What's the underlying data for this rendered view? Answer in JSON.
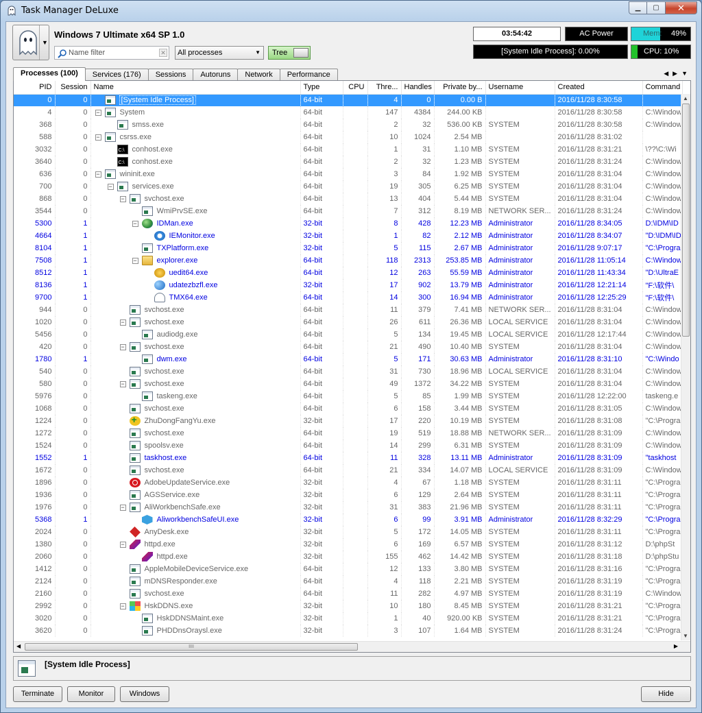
{
  "window": {
    "title": "Task Manager DeLuxe"
  },
  "header": {
    "os_name": "Windows 7 Ultimate x64 SP 1.0",
    "filter_placeholder": "Name filter",
    "process_scope": "All processes",
    "tree_label": "Tree"
  },
  "status": {
    "uptime": "03:54:42",
    "power": "AC Power",
    "mem_label": "Mem:",
    "mem_value": "49%",
    "mem_fraction": 0.49,
    "idle_text": "[System Idle Process]: 0.00%",
    "cpu_label": "CPU:",
    "cpu_value": "10%",
    "cpu_fraction": 0.1
  },
  "tabs": [
    {
      "label": "Processes (100)",
      "active": true
    },
    {
      "label": "Services (176)"
    },
    {
      "label": "Sessions"
    },
    {
      "label": "Autoruns"
    },
    {
      "label": "Network"
    },
    {
      "label": "Performance"
    }
  ],
  "columns": [
    "PID",
    "Session",
    "Name",
    "Type",
    "CPU",
    "Thre...",
    "Handles",
    "Private by...",
    "Username",
    "Created",
    "Command Line"
  ],
  "processes": [
    {
      "pid": "0",
      "session": "0",
      "depth": 0,
      "toggle": "",
      "icon": "win",
      "name": "[System Idle Process]",
      "type": "64-bit",
      "cpu": "",
      "threads": "4",
      "handles": "0",
      "private": "0.00 B",
      "user": "",
      "created": "2016/11/28 8:30:58",
      "cmd": "",
      "selected": true
    },
    {
      "pid": "4",
      "session": "0",
      "depth": 0,
      "toggle": "−",
      "icon": "win",
      "name": "System",
      "type": "64-bit",
      "cpu": "",
      "threads": "147",
      "handles": "4384",
      "private": "244.00 KB",
      "user": "",
      "created": "2016/11/28 8:30:58",
      "cmd": "C:\\Window"
    },
    {
      "pid": "368",
      "session": "0",
      "depth": 1,
      "toggle": "",
      "icon": "win",
      "name": "smss.exe",
      "type": "64-bit",
      "cpu": "",
      "threads": "2",
      "handles": "32",
      "private": "536.00 KB",
      "user": "SYSTEM",
      "created": "2016/11/28 8:30:58",
      "cmd": "C:\\Window"
    },
    {
      "pid": "588",
      "session": "0",
      "depth": 0,
      "toggle": "−",
      "icon": "win",
      "name": "csrss.exe",
      "type": "64-bit",
      "cpu": "",
      "threads": "10",
      "handles": "1024",
      "private": "2.54 MB",
      "user": "",
      "created": "2016/11/28 8:31:02",
      "cmd": ""
    },
    {
      "pid": "3032",
      "session": "0",
      "depth": 1,
      "toggle": "",
      "icon": "cmd",
      "name": "conhost.exe",
      "type": "64-bit",
      "cpu": "",
      "threads": "1",
      "handles": "31",
      "private": "1.10 MB",
      "user": "SYSTEM",
      "created": "2016/11/28 8:31:21",
      "cmd": "\\??\\C:\\Wi"
    },
    {
      "pid": "3640",
      "session": "0",
      "depth": 1,
      "toggle": "",
      "icon": "cmd",
      "name": "conhost.exe",
      "type": "64-bit",
      "cpu": "",
      "threads": "2",
      "handles": "32",
      "private": "1.23 MB",
      "user": "SYSTEM",
      "created": "2016/11/28 8:31:24",
      "cmd": "C:\\Window"
    },
    {
      "pid": "636",
      "session": "0",
      "depth": 0,
      "toggle": "−",
      "icon": "win",
      "name": "wininit.exe",
      "type": "64-bit",
      "cpu": "",
      "threads": "3",
      "handles": "84",
      "private": "1.92 MB",
      "user": "SYSTEM",
      "created": "2016/11/28 8:31:04",
      "cmd": "C:\\Window"
    },
    {
      "pid": "700",
      "session": "0",
      "depth": 1,
      "toggle": "−",
      "icon": "win",
      "name": "services.exe",
      "type": "64-bit",
      "cpu": "",
      "threads": "19",
      "handles": "305",
      "private": "6.25 MB",
      "user": "SYSTEM",
      "created": "2016/11/28 8:31:04",
      "cmd": "C:\\Window"
    },
    {
      "pid": "868",
      "session": "0",
      "depth": 2,
      "toggle": "−",
      "icon": "win",
      "name": "svchost.exe",
      "type": "64-bit",
      "cpu": "",
      "threads": "13",
      "handles": "404",
      "private": "5.44 MB",
      "user": "SYSTEM",
      "created": "2016/11/28 8:31:04",
      "cmd": "C:\\Window"
    },
    {
      "pid": "3544",
      "session": "0",
      "depth": 3,
      "toggle": "",
      "icon": "win",
      "name": "WmiPrvSE.exe",
      "type": "64-bit",
      "cpu": "",
      "threads": "7",
      "handles": "312",
      "private": "8.19 MB",
      "user": "NETWORK SER...",
      "created": "2016/11/28 8:31:24",
      "cmd": "C:\\Window"
    },
    {
      "pid": "5300",
      "session": "1",
      "depth": 3,
      "toggle": "−",
      "icon": "globe",
      "name": "IDMan.exe",
      "type": "32-bit",
      "cpu": "",
      "threads": "8",
      "handles": "428",
      "private": "12.23 MB",
      "user": "Administrator",
      "created": "2016/11/28 8:34:05",
      "cmd": "D:\\IDM\\ID",
      "userproc": true
    },
    {
      "pid": "4664",
      "session": "1",
      "depth": 4,
      "toggle": "",
      "icon": "ie",
      "name": "IEMonitor.exe",
      "type": "32-bit",
      "cpu": "",
      "threads": "1",
      "handles": "82",
      "private": "2.12 MB",
      "user": "Administrator",
      "created": "2016/11/28 8:34:07",
      "cmd": "\"D:\\IDM\\ID",
      "userproc": true
    },
    {
      "pid": "8104",
      "session": "1",
      "depth": 3,
      "toggle": "",
      "icon": "win",
      "name": "TXPlatform.exe",
      "type": "32-bit",
      "cpu": "",
      "threads": "5",
      "handles": "115",
      "private": "2.67 MB",
      "user": "Administrator",
      "created": "2016/11/28 9:07:17",
      "cmd": "\"C:\\Progra",
      "userproc": true
    },
    {
      "pid": "7508",
      "session": "1",
      "depth": 3,
      "toggle": "−",
      "icon": "folder",
      "name": "explorer.exe",
      "type": "64-bit",
      "cpu": "",
      "threads": "118",
      "handles": "2313",
      "private": "253.85 MB",
      "user": "Administrator",
      "created": "2016/11/28 11:05:14",
      "cmd": "C:\\Window",
      "userproc": true
    },
    {
      "pid": "8512",
      "session": "1",
      "depth": 4,
      "toggle": "",
      "icon": "ue",
      "name": "uedit64.exe",
      "type": "64-bit",
      "cpu": "",
      "threads": "12",
      "handles": "263",
      "private": "55.59 MB",
      "user": "Administrator",
      "created": "2016/11/28 11:43:34",
      "cmd": "\"D:\\UltraE",
      "userproc": true
    },
    {
      "pid": "8136",
      "session": "1",
      "depth": 4,
      "toggle": "",
      "icon": "upd",
      "name": "udatezbzfl.exe",
      "type": "32-bit",
      "cpu": "",
      "threads": "17",
      "handles": "902",
      "private": "13.79 MB",
      "user": "Administrator",
      "created": "2016/11/28 12:21:14",
      "cmd": "\"F:\\软件\\",
      "userproc": true
    },
    {
      "pid": "9700",
      "session": "1",
      "depth": 4,
      "toggle": "",
      "icon": "ghost",
      "name": "TMX64.exe",
      "type": "64-bit",
      "cpu": "",
      "threads": "14",
      "handles": "300",
      "private": "16.94 MB",
      "user": "Administrator",
      "created": "2016/11/28 12:25:29",
      "cmd": "\"F:\\软件\\",
      "userproc": true
    },
    {
      "pid": "944",
      "session": "0",
      "depth": 2,
      "toggle": "",
      "icon": "win",
      "name": "svchost.exe",
      "type": "64-bit",
      "cpu": "",
      "threads": "11",
      "handles": "379",
      "private": "7.41 MB",
      "user": "NETWORK SER...",
      "created": "2016/11/28 8:31:04",
      "cmd": "C:\\Window"
    },
    {
      "pid": "1020",
      "session": "0",
      "depth": 2,
      "toggle": "−",
      "icon": "win",
      "name": "svchost.exe",
      "type": "64-bit",
      "cpu": "",
      "threads": "26",
      "handles": "611",
      "private": "26.36 MB",
      "user": "LOCAL SERVICE",
      "created": "2016/11/28 8:31:04",
      "cmd": "C:\\Window"
    },
    {
      "pid": "5456",
      "session": "0",
      "depth": 3,
      "toggle": "",
      "icon": "win",
      "name": "audiodg.exe",
      "type": "64-bit",
      "cpu": "",
      "threads": "5",
      "handles": "134",
      "private": "19.45 MB",
      "user": "LOCAL SERVICE",
      "created": "2016/11/28 12:17:44",
      "cmd": "C:\\Window"
    },
    {
      "pid": "420",
      "session": "0",
      "depth": 2,
      "toggle": "−",
      "icon": "win",
      "name": "svchost.exe",
      "type": "64-bit",
      "cpu": "",
      "threads": "21",
      "handles": "490",
      "private": "10.40 MB",
      "user": "SYSTEM",
      "created": "2016/11/28 8:31:04",
      "cmd": "C:\\Window"
    },
    {
      "pid": "1780",
      "session": "1",
      "depth": 3,
      "toggle": "",
      "icon": "win",
      "name": "dwm.exe",
      "type": "64-bit",
      "cpu": "",
      "threads": "5",
      "handles": "171",
      "private": "30.63 MB",
      "user": "Administrator",
      "created": "2016/11/28 8:31:10",
      "cmd": "\"C:\\Windo",
      "userproc": true
    },
    {
      "pid": "540",
      "session": "0",
      "depth": 2,
      "toggle": "",
      "icon": "win",
      "name": "svchost.exe",
      "type": "64-bit",
      "cpu": "",
      "threads": "31",
      "handles": "730",
      "private": "18.96 MB",
      "user": "LOCAL SERVICE",
      "created": "2016/11/28 8:31:04",
      "cmd": "C:\\Window"
    },
    {
      "pid": "580",
      "session": "0",
      "depth": 2,
      "toggle": "−",
      "icon": "win",
      "name": "svchost.exe",
      "type": "64-bit",
      "cpu": "",
      "threads": "49",
      "handles": "1372",
      "private": "34.22 MB",
      "user": "SYSTEM",
      "created": "2016/11/28 8:31:04",
      "cmd": "C:\\Window"
    },
    {
      "pid": "5976",
      "session": "0",
      "depth": 3,
      "toggle": "",
      "icon": "win",
      "name": "taskeng.exe",
      "type": "64-bit",
      "cpu": "",
      "threads": "5",
      "handles": "85",
      "private": "1.99 MB",
      "user": "SYSTEM",
      "created": "2016/11/28 12:22:00",
      "cmd": "taskeng.e"
    },
    {
      "pid": "1068",
      "session": "0",
      "depth": 2,
      "toggle": "",
      "icon": "win",
      "name": "svchost.exe",
      "type": "64-bit",
      "cpu": "",
      "threads": "6",
      "handles": "158",
      "private": "3.44 MB",
      "user": "SYSTEM",
      "created": "2016/11/28 8:31:05",
      "cmd": "C:\\Window"
    },
    {
      "pid": "1224",
      "session": "0",
      "depth": 2,
      "toggle": "",
      "icon": "plus",
      "name": "ZhuDongFangYu.exe",
      "type": "32-bit",
      "cpu": "",
      "threads": "17",
      "handles": "220",
      "private": "10.19 MB",
      "user": "SYSTEM",
      "created": "2016/11/28 8:31:08",
      "cmd": "\"C:\\Progra"
    },
    {
      "pid": "1272",
      "session": "0",
      "depth": 2,
      "toggle": "",
      "icon": "win",
      "name": "svchost.exe",
      "type": "64-bit",
      "cpu": "",
      "threads": "19",
      "handles": "519",
      "private": "18.88 MB",
      "user": "NETWORK SER...",
      "created": "2016/11/28 8:31:09",
      "cmd": "C:\\Window"
    },
    {
      "pid": "1524",
      "session": "0",
      "depth": 2,
      "toggle": "",
      "icon": "win",
      "name": "spoolsv.exe",
      "type": "64-bit",
      "cpu": "",
      "threads": "14",
      "handles": "299",
      "private": "6.31 MB",
      "user": "SYSTEM",
      "created": "2016/11/28 8:31:09",
      "cmd": "C:\\Window"
    },
    {
      "pid": "1552",
      "session": "1",
      "depth": 2,
      "toggle": "",
      "icon": "win",
      "name": "taskhost.exe",
      "type": "64-bit",
      "cpu": "",
      "threads": "11",
      "handles": "328",
      "private": "13.11 MB",
      "user": "Administrator",
      "created": "2016/11/28 8:31:09",
      "cmd": "\"taskhost",
      "userproc": true
    },
    {
      "pid": "1672",
      "session": "0",
      "depth": 2,
      "toggle": "",
      "icon": "win",
      "name": "svchost.exe",
      "type": "64-bit",
      "cpu": "",
      "threads": "21",
      "handles": "334",
      "private": "14.07 MB",
      "user": "LOCAL SERVICE",
      "created": "2016/11/28 8:31:09",
      "cmd": "C:\\Window"
    },
    {
      "pid": "1896",
      "session": "0",
      "depth": 2,
      "toggle": "",
      "icon": "adobe",
      "name": "AdobeUpdateService.exe",
      "type": "32-bit",
      "cpu": "",
      "threads": "4",
      "handles": "67",
      "private": "1.18 MB",
      "user": "SYSTEM",
      "created": "2016/11/28 8:31:11",
      "cmd": "\"C:\\Progra"
    },
    {
      "pid": "1936",
      "session": "0",
      "depth": 2,
      "toggle": "",
      "icon": "win",
      "name": "AGSService.exe",
      "type": "32-bit",
      "cpu": "",
      "threads": "6",
      "handles": "129",
      "private": "2.64 MB",
      "user": "SYSTEM",
      "created": "2016/11/28 8:31:11",
      "cmd": "\"C:\\Progra"
    },
    {
      "pid": "1976",
      "session": "0",
      "depth": 2,
      "toggle": "−",
      "icon": "win",
      "name": "AliWorkbenchSafe.exe",
      "type": "32-bit",
      "cpu": "",
      "threads": "31",
      "handles": "383",
      "private": "21.96 MB",
      "user": "SYSTEM",
      "created": "2016/11/28 8:31:11",
      "cmd": "\"C:\\Progra"
    },
    {
      "pid": "5368",
      "session": "1",
      "depth": 3,
      "toggle": "",
      "icon": "hex",
      "name": "AliworkbenchSafeUI.exe",
      "type": "32-bit",
      "cpu": "",
      "threads": "6",
      "handles": "99",
      "private": "3.91 MB",
      "user": "Administrator",
      "created": "2016/11/28 8:32:29",
      "cmd": "\"C:\\Progra",
      "userproc": true
    },
    {
      "pid": "2024",
      "session": "0",
      "depth": 2,
      "toggle": "",
      "icon": "diamond",
      "name": "AnyDesk.exe",
      "type": "32-bit",
      "cpu": "",
      "threads": "5",
      "handles": "172",
      "private": "14.05 MB",
      "user": "SYSTEM",
      "created": "2016/11/28 8:31:11",
      "cmd": "\"C:\\Progra"
    },
    {
      "pid": "1380",
      "session": "0",
      "depth": 2,
      "toggle": "−",
      "icon": "feather",
      "name": "httpd.exe",
      "type": "32-bit",
      "cpu": "",
      "threads": "6",
      "handles": "169",
      "private": "6.57 MB",
      "user": "SYSTEM",
      "created": "2016/11/28 8:31:12",
      "cmd": "D:\\phpSt"
    },
    {
      "pid": "2060",
      "session": "0",
      "depth": 3,
      "toggle": "",
      "icon": "feather",
      "name": "httpd.exe",
      "type": "32-bit",
      "cpu": "",
      "threads": "155",
      "handles": "462",
      "private": "14.42 MB",
      "user": "SYSTEM",
      "created": "2016/11/28 8:31:18",
      "cmd": "D:\\phpStu"
    },
    {
      "pid": "1412",
      "session": "0",
      "depth": 2,
      "toggle": "",
      "icon": "win",
      "name": "AppleMobileDeviceService.exe",
      "type": "64-bit",
      "cpu": "",
      "threads": "12",
      "handles": "133",
      "private": "3.80 MB",
      "user": "SYSTEM",
      "created": "2016/11/28 8:31:16",
      "cmd": "\"C:\\Progra"
    },
    {
      "pid": "2124",
      "session": "0",
      "depth": 2,
      "toggle": "",
      "icon": "win",
      "name": "mDNSResponder.exe",
      "type": "64-bit",
      "cpu": "",
      "threads": "4",
      "handles": "118",
      "private": "2.21 MB",
      "user": "SYSTEM",
      "created": "2016/11/28 8:31:19",
      "cmd": "\"C:\\Progra"
    },
    {
      "pid": "2160",
      "session": "0",
      "depth": 2,
      "toggle": "",
      "icon": "win",
      "name": "svchost.exe",
      "type": "64-bit",
      "cpu": "",
      "threads": "11",
      "handles": "282",
      "private": "4.97 MB",
      "user": "SYSTEM",
      "created": "2016/11/28 8:31:19",
      "cmd": "C:\\Window"
    },
    {
      "pid": "2992",
      "session": "0",
      "depth": 2,
      "toggle": "−",
      "icon": "cube",
      "name": "HskDDNS.exe",
      "type": "32-bit",
      "cpu": "",
      "threads": "10",
      "handles": "180",
      "private": "8.45 MB",
      "user": "SYSTEM",
      "created": "2016/11/28 8:31:21",
      "cmd": "\"C:\\Progra"
    },
    {
      "pid": "3020",
      "session": "0",
      "depth": 3,
      "toggle": "",
      "icon": "win",
      "name": "HskDDNSMaint.exe",
      "type": "32-bit",
      "cpu": "",
      "threads": "1",
      "handles": "40",
      "private": "920.00 KB",
      "user": "SYSTEM",
      "created": "2016/11/28 8:31:21",
      "cmd": "\"C:\\Progra"
    },
    {
      "pid": "3620",
      "session": "0",
      "depth": 3,
      "toggle": "",
      "icon": "win",
      "name": "PHDDnsOraysl.exe",
      "type": "32-bit",
      "cpu": "",
      "threads": "3",
      "handles": "107",
      "private": "1.64 MB",
      "user": "SYSTEM",
      "created": "2016/11/28 8:31:24",
      "cmd": "\"C:\\Progra"
    }
  ],
  "detail": {
    "selected_name": "[System Idle Process]"
  },
  "buttons": {
    "terminate": "Terminate",
    "monitor": "Monitor",
    "windows": "Windows",
    "hide": "Hide"
  },
  "scroll": {
    "grip": "IIII"
  }
}
